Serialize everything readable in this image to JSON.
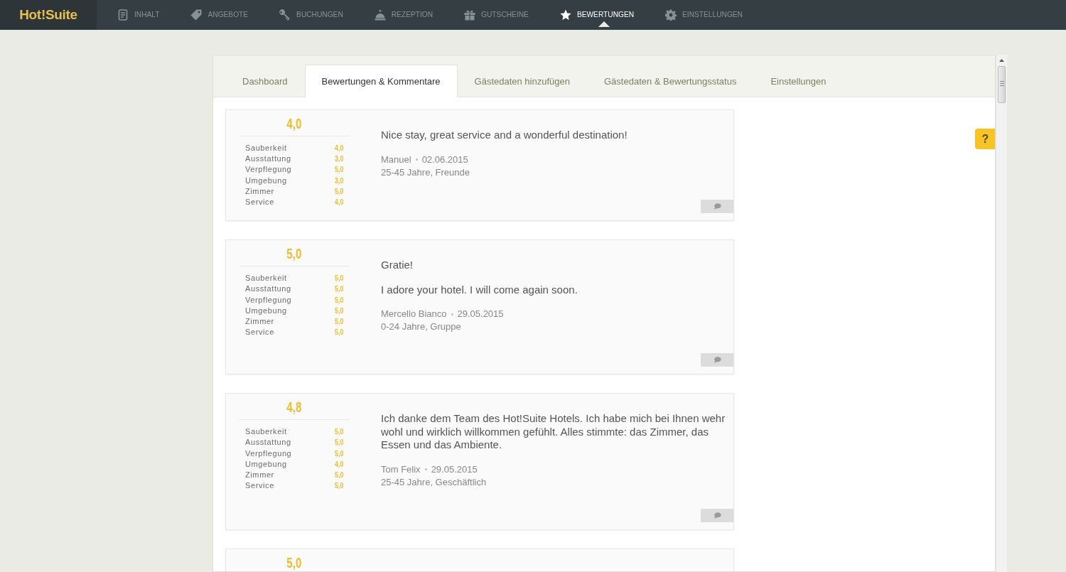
{
  "app": {
    "logo": "Hot!Suite"
  },
  "nav": [
    {
      "label": "INHALT",
      "selected": false
    },
    {
      "label": "ANGEBOTE",
      "selected": false
    },
    {
      "label": "BUCHUNGEN",
      "selected": false
    },
    {
      "label": "REZEPTION",
      "selected": false
    },
    {
      "label": "GUTSCHEINE",
      "selected": false
    },
    {
      "label": "BEWERTUNGEN",
      "selected": true
    },
    {
      "label": "EINSTELLUNGEN",
      "selected": false
    }
  ],
  "tabs": [
    {
      "label": "Dashboard",
      "selected": false
    },
    {
      "label": "Bewertungen & Kommentare",
      "selected": true
    },
    {
      "label": "Gästedaten hinzufügen",
      "selected": false
    },
    {
      "label": "Gästedaten & Bewertungsstatus",
      "selected": false
    },
    {
      "label": "Einstellungen",
      "selected": false
    }
  ],
  "help_button": {
    "label": "?"
  },
  "reviews": [
    {
      "score": "4,0",
      "ratings": [
        {
          "category": "Sauberkeit",
          "value": "4,0"
        },
        {
          "category": "Ausstattung",
          "value": "3,0"
        },
        {
          "category": "Verpflegung",
          "value": "5,0"
        },
        {
          "category": "Umgebung",
          "value": "3,0"
        },
        {
          "category": "Zimmer",
          "value": "5,0"
        },
        {
          "category": "Service",
          "value": "4,0"
        }
      ],
      "comment": [
        "Nice stay, great service and a wonderful destination!"
      ],
      "author": "Manuel",
      "date": "02.06.2015",
      "guest_info": "25-45 Jahre, Freunde"
    },
    {
      "score": "5,0",
      "ratings": [
        {
          "category": "Sauberkeit",
          "value": "5,0"
        },
        {
          "category": "Ausstattung",
          "value": "5,0"
        },
        {
          "category": "Verpflegung",
          "value": "5,0"
        },
        {
          "category": "Umgebung",
          "value": "5,0"
        },
        {
          "category": "Zimmer",
          "value": "5,0"
        },
        {
          "category": "Service",
          "value": "5,0"
        }
      ],
      "comment": [
        "Gratie!",
        "I adore your hotel. I will come again soon."
      ],
      "author": "Mercello Bianco",
      "date": "29.05.2015",
      "guest_info": "0-24 Jahre, Gruppe"
    },
    {
      "score": "4,8",
      "ratings": [
        {
          "category": "Sauberkeit",
          "value": "5,0"
        },
        {
          "category": "Ausstattung",
          "value": "5,0"
        },
        {
          "category": "Verpflegung",
          "value": "5,0"
        },
        {
          "category": "Umgebung",
          "value": "4,0"
        },
        {
          "category": "Zimmer",
          "value": "5,0"
        },
        {
          "category": "Service",
          "value": "5,0"
        }
      ],
      "comment": [
        "Ich danke dem Team des Hot!Suite Hotels. Ich habe mich bei Ihnen wehr wohl und wirklich willkommen gefühlt. Alles stimmte: das Zimmer, das Essen und das Ambiente."
      ],
      "author": "Tom Felix",
      "date": "29.05.2015",
      "guest_info": "25-45 Jahre, Geschäftlich"
    },
    {
      "score": "5,0"
    }
  ]
}
